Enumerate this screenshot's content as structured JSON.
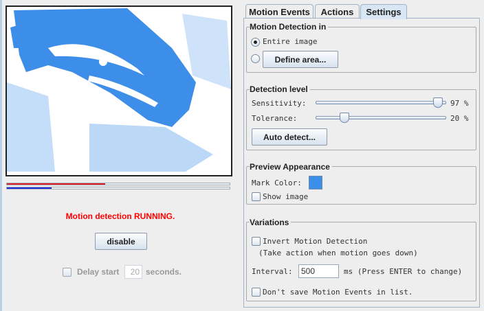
{
  "preview": {
    "mark_color": "#3d8ee8"
  },
  "meters": {
    "red_level": 0.44,
    "blue_level": 0.2
  },
  "status_text": "Motion detection RUNNING.",
  "disable_label": "disable",
  "delay": {
    "label": "Delay start",
    "value": "20",
    "unit": "seconds.",
    "checked": false
  },
  "tabs": [
    {
      "label": "Motion Events"
    },
    {
      "label": "Actions"
    },
    {
      "label": "Settings",
      "selected": true
    }
  ],
  "settings": {
    "motion_detection_in": {
      "title": "Motion Detection in",
      "entire_image": "Entire image",
      "define_area": "Define area..."
    },
    "detection_level": {
      "title": "Detection level",
      "sensitivity_label": "Sensitivity:",
      "sensitivity_value": 97,
      "sensitivity_text": "97 %",
      "tolerance_label": "Tolerance:",
      "tolerance_value": 20,
      "tolerance_text": "20 %",
      "auto_detect": "Auto detect..."
    },
    "preview_appearance": {
      "title": "Preview Appearance",
      "mark_color_label": "Mark Color:",
      "mark_color": "#3d8ee8",
      "show_image": "Show image"
    },
    "variations": {
      "title": "Variations",
      "invert": "Invert Motion Detection",
      "invert_hint": "(Take action when motion goes down)",
      "interval_label": "Interval:",
      "interval_value": "500",
      "interval_unit": "ms (Press ENTER to change)",
      "dont_save": "Don't save Motion Events in list."
    }
  }
}
